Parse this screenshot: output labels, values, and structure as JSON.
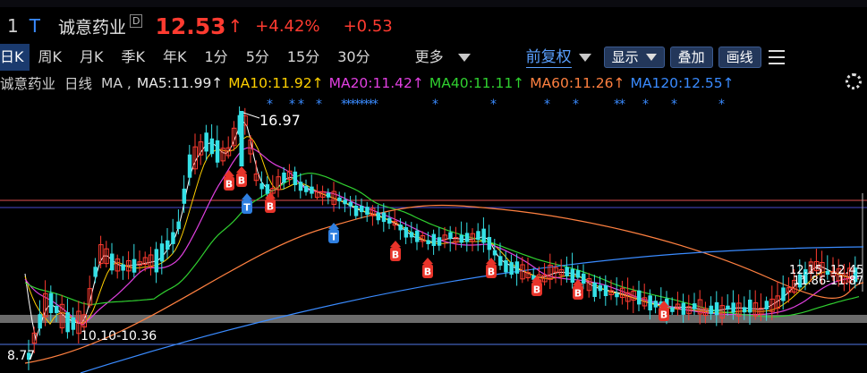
{
  "header": {
    "stock_code_fragment": "1",
    "t_badge": "T",
    "stock_name": "诚意药业",
    "d_badge": "D",
    "price": "12.53",
    "arrow": "↑",
    "change_pct": "+4.42%",
    "change": "+0.53"
  },
  "periods": {
    "day": "日K",
    "week": "周K",
    "month": "月K",
    "quarter": "季K",
    "year": "年K",
    "m1": "1分",
    "m5": "5分",
    "m15": "15分",
    "m30": "30分",
    "more": "更多"
  },
  "toolbar": {
    "adjust": "前复权",
    "display": "显示",
    "overlay": "叠加",
    "draw": "画线"
  },
  "ma_bar": {
    "name": "诚意药业",
    "kline": "日线",
    "ma": "MA ,",
    "ma5": "MA5:11.99↑",
    "ma10": "MA10:11.92↑",
    "ma20": "MA20:11.42↑",
    "ma40": "MA40:11.11↑",
    "ma60": "MA60:11.26↑",
    "ma120": "MA120:12.55↑"
  },
  "colors": {
    "up": "#ff3b30",
    "down": "#35e0e6",
    "ma5": "#ffffff",
    "ma10": "#ffd000",
    "ma20": "#e040e0",
    "ma40": "#30d030",
    "ma60": "#ff8040",
    "ma120": "#3a8bff"
  },
  "chart_data": {
    "type": "candlestick",
    "annotations": {
      "high": "16.97",
      "low_band": "10.10-10.36",
      "left_low": "8.77",
      "right_label_top": "12.15",
      "right_label_top2": "12.45",
      "right_label_bottom": "11.86-11.87"
    },
    "markers": {
      "b": "B",
      "t": "T",
      "star": "*"
    }
  }
}
